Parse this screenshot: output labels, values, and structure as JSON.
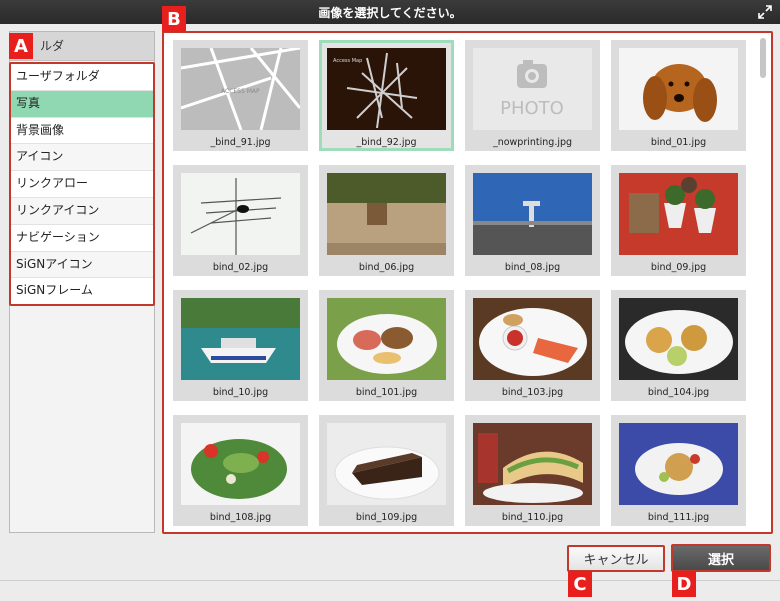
{
  "window": {
    "title": "画像を選択してください。"
  },
  "sidebar": {
    "header": "ルダ",
    "items": [
      {
        "label": "ユーザフォルダ"
      },
      {
        "label": "写真"
      },
      {
        "label": "背景画像"
      },
      {
        "label": "アイコン"
      },
      {
        "label": "リンクアロー"
      },
      {
        "label": "リンクアイコン"
      },
      {
        "label": "ナビゲーション"
      },
      {
        "label": "SiGNアイコン"
      },
      {
        "label": "SiGNフレーム"
      }
    ],
    "selected_index": 1
  },
  "grid": {
    "items": [
      {
        "name": "_bind_91.jpg"
      },
      {
        "name": "_bind_92.jpg"
      },
      {
        "name": "_nowprinting.jpg"
      },
      {
        "name": "bind_01.jpg"
      },
      {
        "name": "bind_02.jpg"
      },
      {
        "name": "bind_06.jpg"
      },
      {
        "name": "bind_08.jpg"
      },
      {
        "name": "bind_09.jpg"
      },
      {
        "name": "bind_10.jpg"
      },
      {
        "name": "bind_101.jpg"
      },
      {
        "name": "bind_103.jpg"
      },
      {
        "name": "bind_104.jpg"
      },
      {
        "name": "bind_108.jpg"
      },
      {
        "name": "bind_109.jpg"
      },
      {
        "name": "bind_110.jpg"
      },
      {
        "name": "bind_111.jpg"
      }
    ],
    "selected_index": 1,
    "thumb_text": {
      "map_label": "ACCESS MAP",
      "map_label_small": "Access Map",
      "photo_label": "PHOTO"
    }
  },
  "buttons": {
    "cancel": "キャンセル",
    "select": "選択"
  },
  "markers": {
    "a": "A",
    "b": "B",
    "c": "C",
    "d": "D"
  },
  "colors": {
    "accent_red": "#c0392b",
    "marker_red": "#e8201d",
    "selected_green": "#8fd8b2"
  }
}
